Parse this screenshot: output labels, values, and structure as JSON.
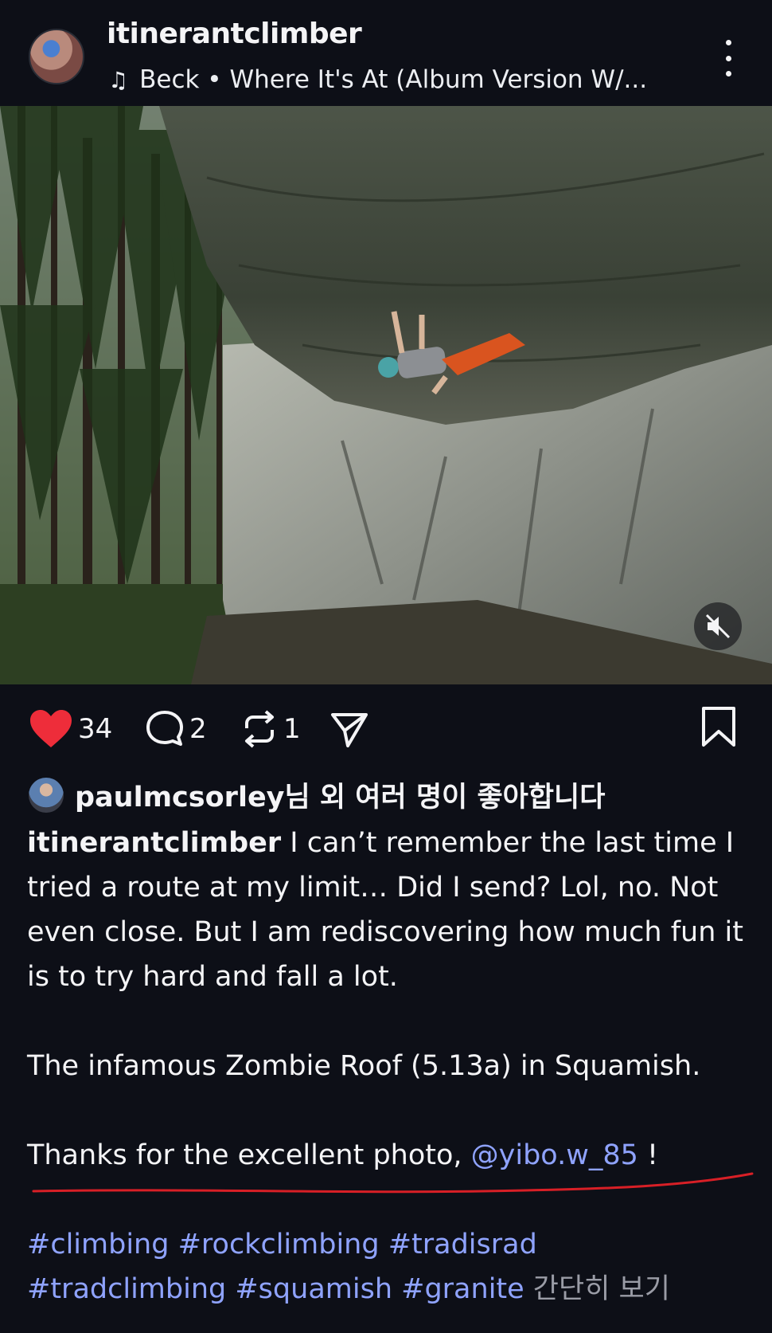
{
  "header": {
    "username": "itinerantclimber",
    "music_icon": "music-note-icon",
    "music_text": "Beck • Where It's At (Album Version W/..."
  },
  "actions": {
    "likes_count": "34",
    "comments_count": "2",
    "reposts_count": "1"
  },
  "likes_line": {
    "user": "paulmcsorley",
    "suffix": "님 외 여러 명이 좋아합니다"
  },
  "caption": {
    "author": "itinerantclimber",
    "line1": " I can’t remember the last time I tried a route at my limit… Did I send? Lol, no. Not even close. But I am rediscovering how much fun it is to try hard and fall a lot.",
    "line2": "The infamous Zombie Roof (5.13a) in Squamish.",
    "thanks_prefix": "Thanks for the excellent photo, ",
    "mention": "@yibo.w_85",
    "thanks_suffix": " !",
    "hashtags_line1": "#climbing #rockclimbing #tradisrad",
    "hashtags_line2": "#tradclimbing #squamish #granite",
    "more_label": " 간단히 보기"
  },
  "colors": {
    "background": "#0d0f17",
    "like_red": "#ee2d3a",
    "link_blue": "#8fa3ff",
    "annotation_red": "#d81f26"
  }
}
